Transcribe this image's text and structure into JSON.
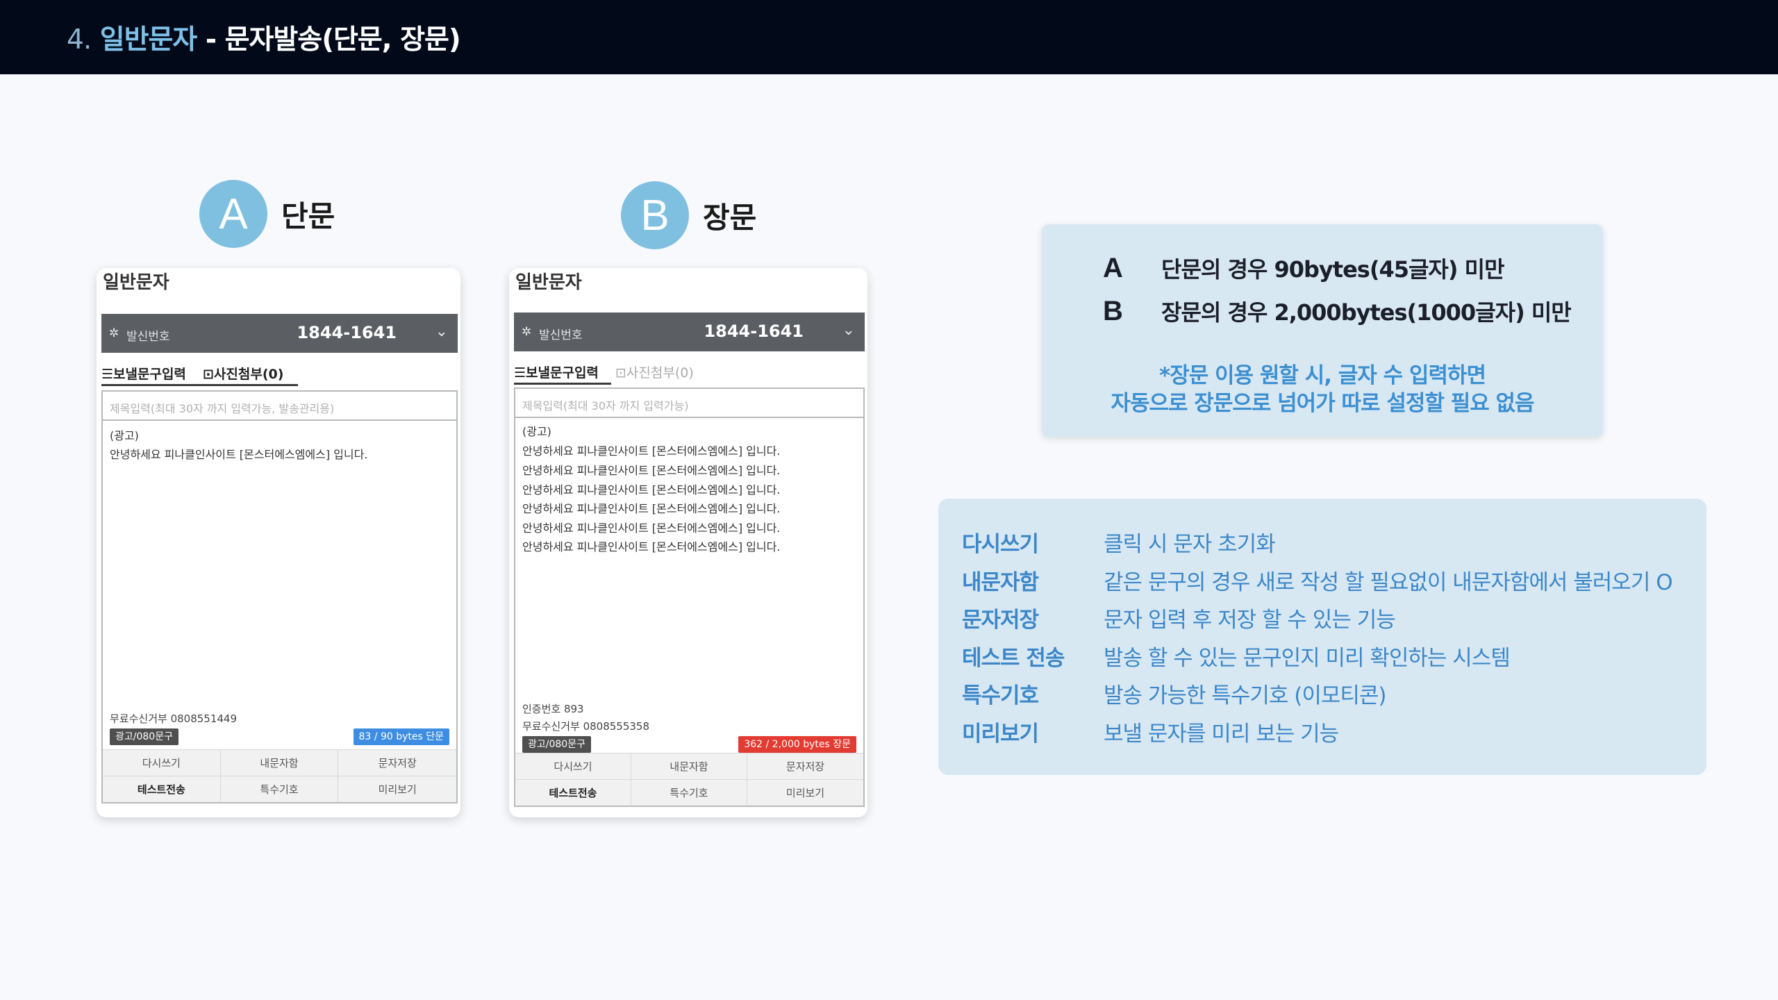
{
  "header": {
    "number": "4.",
    "category": "일반문자",
    "separator": " - ",
    "subtitle": "문자발송(단문, 장문)"
  },
  "headings": [
    {
      "letter": "A",
      "label": "단문"
    },
    {
      "letter": "B",
      "label": "장문"
    }
  ],
  "phone_a": {
    "title": "일반문자",
    "sender_label": "발신번호",
    "sender_number": "1844-1641",
    "tab_text": "☰보낼문구입력",
    "tab_photo": "⊡사진첨부(0)",
    "subject_placeholder": "제목입력(최대 30자 까지 입력가능, 발송관리용)",
    "message_lines": [
      "(광고)",
      "안녕하세요 피나클인사이트 [몬스터에스엠에스] 입니다."
    ],
    "opt_out": "무료수신거부 0808551449",
    "ad_badge": "광고/080문구",
    "bytes": "83 / 90 bytes 단문",
    "bytes_color": "#3d8ee3",
    "buttons": [
      "다시쓰기",
      "내문자함",
      "문자저장",
      "테스트전송",
      "특수기호",
      "미리보기"
    ]
  },
  "phone_b": {
    "title": "일반문자",
    "sender_label": "발신번호",
    "sender_number": "1844-1641",
    "tab_text": "☰보낼문구입력",
    "tab_photo": "⊡사진첨부(0)",
    "subject_placeholder": "제목입력(최대 30자 까지 입력가능)",
    "message_lines": [
      "(광고)",
      "안녕하세요 피나클인사이트 [몬스터에스엠에스] 입니다.",
      "안녕하세요 피나클인사이트 [몬스터에스엠에스] 입니다.",
      "안녕하세요 피나클인사이트 [몬스터에스엠에스] 입니다.",
      "안녕하세요 피나클인사이트 [몬스터에스엠에스] 입니다.",
      "안녕하세요 피나클인사이트 [몬스터에스엠에스] 입니다.",
      "안녕하세요 피나클인사이트 [몬스터에스엠에스] 입니다."
    ],
    "auth_number": "인증번호 893",
    "opt_out": "무료수신거부 0808555358",
    "ad_badge": "광고/080문구",
    "bytes": "362 / 2,000 bytes 장문",
    "bytes_color": "#e23b32",
    "buttons": [
      "다시쓰기",
      "내문자함",
      "문자저장",
      "테스트전송",
      "특수기호",
      "미리보기"
    ]
  },
  "info_limits": {
    "rows": [
      {
        "key": "A",
        "text": "단문의 경우 90bytes(45글자) 미만"
      },
      {
        "key": "B",
        "text": "장문의 경우 2,000bytes(1000글자) 미만"
      }
    ],
    "note_line1": "*장문 이용 원할 시, 글자 수 입력하면",
    "note_line2": "자동으로 장문으로 넘어가 따로 설정할 필요 없음"
  },
  "info_buttons": [
    {
      "name": "다시쓰기",
      "desc": "클릭 시 문자 초기화"
    },
    {
      "name": "내문자함",
      "desc": "같은 문구의 경우 새로 작성 할 필요없이 내문자함에서 불러오기 O"
    },
    {
      "name": "문자저장",
      "desc": "문자 입력 후 저장 할 수 있는 기능"
    },
    {
      "name": "테스트 전송",
      "desc": "발송 할 수 있는 문구인지 미리 확인하는 시스템"
    },
    {
      "name": "특수기호",
      "desc": "발송 가능한 특수기호 (이모티콘)"
    },
    {
      "name": "미리보기",
      "desc": "보낼 문자를 미리 보는 기능"
    }
  ],
  "colors": {
    "header_bg": "#020a1a",
    "accent_blue": "#3c87c8",
    "circle": "#7fbfe0",
    "panel": "#d8e8f3"
  }
}
